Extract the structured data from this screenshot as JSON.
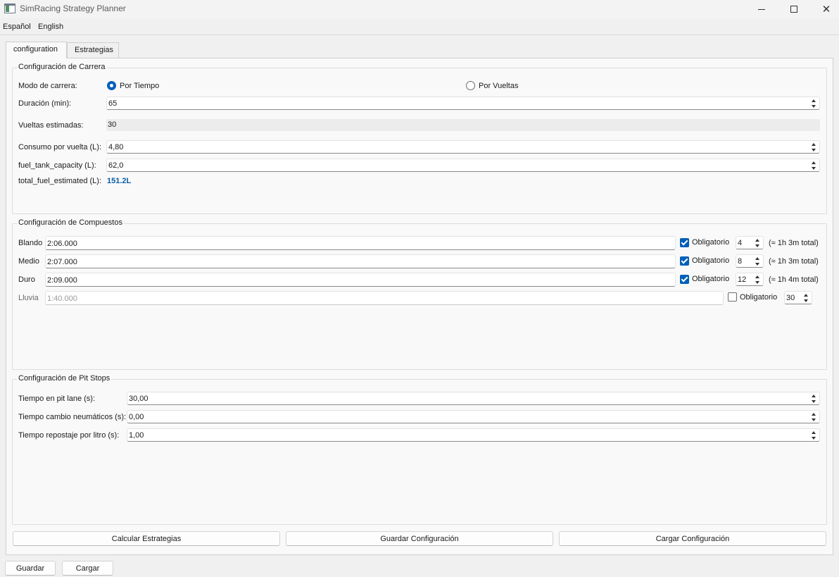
{
  "window": {
    "title": "SimRacing Strategy Planner"
  },
  "menu": {
    "items": [
      "Español",
      "English"
    ]
  },
  "tabs": [
    "configuration",
    "Estrategias"
  ],
  "race": {
    "title": "Configuración de Carrera",
    "mode_label": "Modo de carrera:",
    "mode_time": "Por Tiempo",
    "mode_laps": "Por Vueltas",
    "mode_selected": "Por Tiempo",
    "duration_label": "Duración (min):",
    "duration_value": "65",
    "est_laps_label": "Vueltas estimadas:",
    "est_laps_value": "30",
    "consumption_label": "Consumo por vuelta (L):",
    "consumption_value": "4,80",
    "tank_label": "fuel_tank_capacity (L):",
    "tank_value": "62,0",
    "total_label": "total_fuel_estimated (L):",
    "total_value": "151.2L"
  },
  "compounds": {
    "title": "Configuración de Compuestos",
    "mandatory_label": "Obligatorio",
    "rows": [
      {
        "name": "Blando",
        "time": "2:06.000",
        "mandatory": true,
        "laps": "4",
        "total": "(≈ 1h 3m total)"
      },
      {
        "name": "Medio",
        "time": "2:07.000",
        "mandatory": true,
        "laps": "8",
        "total": "(≈ 1h 3m total)"
      },
      {
        "name": "Duro",
        "time": "2:09.000",
        "mandatory": true,
        "laps": "12",
        "total": "(≈ 1h 4m total)"
      },
      {
        "name": "Lluvia",
        "time": "1:40.000",
        "mandatory": false,
        "laps": "30",
        "total": ""
      }
    ]
  },
  "pit": {
    "title": "Configuración de Pit Stops",
    "pitlane_label": "Tiempo en pit lane (s):",
    "pitlane_value": "30,00",
    "tyres_label": "Tiempo cambio neumáticos (s):",
    "tyres_value": "0,00",
    "refuel_label": "Tiempo repostaje por litro (s):",
    "refuel_value": "1,00"
  },
  "actions": {
    "calculate": "Calcular Estrategias",
    "save_config": "Guardar Configuración",
    "load_config": "Cargar Configuración"
  },
  "footer": {
    "save": "Guardar",
    "load": "Cargar"
  },
  "colors": {
    "accent": "#005fb8",
    "fuel_total": "#0a5da8"
  }
}
